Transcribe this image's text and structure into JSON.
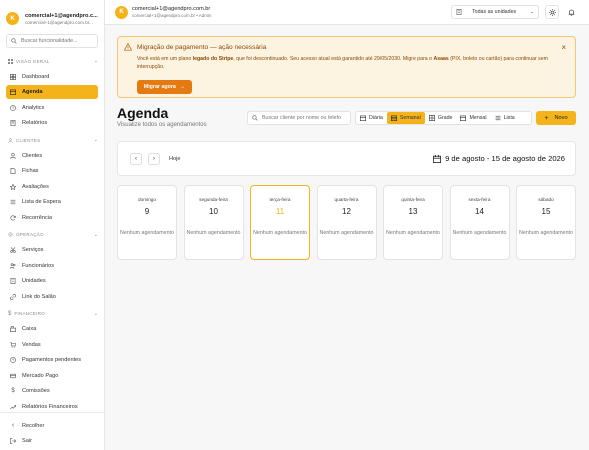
{
  "sidebar": {
    "avatar_initial": "K",
    "user_name": "comercial+1@agendpro.c...",
    "user_email": "comercial+1@agendpro.com.br...",
    "search_placeholder": "Buscar funcionalidade...",
    "sections": [
      {
        "label": "VISÃO GERAL",
        "items": [
          "Dashboard",
          "Agenda",
          "Analytics",
          "Relatórios"
        ]
      },
      {
        "label": "CLIENTES",
        "items": [
          "Clientes",
          "Fichas",
          "Avaliações",
          "Lista de Espera",
          "Recorrência"
        ]
      },
      {
        "label": "OPERAÇÃO",
        "items": [
          "Serviços",
          "Funcionários",
          "Unidades",
          "Link do Salão"
        ]
      },
      {
        "label": "FINANCEIRO",
        "items": [
          "Caixa",
          "Vendas",
          "Pagamentos pendentes",
          "Mercado Pago",
          "Comissões",
          "Relatórios Financeiros"
        ]
      }
    ],
    "active_item": "Agenda",
    "collapse_label": "Recolher",
    "logout_label": "Sair"
  },
  "topbar": {
    "avatar_initial": "K",
    "user_name": "comercial+1@agendpro.com.br",
    "user_sub": "comercial+1@agendpro.com.br • Admin",
    "unit_select": "Todas as unidades"
  },
  "banner": {
    "title": "Migração de pagamento — ação necessária",
    "msg_part1": "Você está em um plano ",
    "msg_bold1": "legado do Stripe",
    "msg_part2": ", que foi descontinuado. Seu acesso atual está garantido até 29/05/2030. Migre para o ",
    "msg_bold2": "Asaas",
    "msg_part3": " (PIX, boleto ou cartão) para continuar sem interrupção.",
    "button": "Migrar agora"
  },
  "page": {
    "title": "Agenda",
    "subtitle": "Visualize todos os agendamentos",
    "search_placeholder": "Buscar cliente por nome ou telefo",
    "views": [
      "Diária",
      "Semanal",
      "Grade",
      "Mensal",
      "Lista"
    ],
    "active_view": "Semanal",
    "new_button": "Novo",
    "today_label": "Hoje",
    "date_range": "9 de agosto - 15 de agosto de 2026"
  },
  "week": {
    "empty_label": "Nenhum agendamento",
    "days": [
      {
        "name": "domingo",
        "num": "9"
      },
      {
        "name": "segunda-feira",
        "num": "10"
      },
      {
        "name": "terça-feira",
        "num": "11"
      },
      {
        "name": "quarta-feira",
        "num": "12"
      },
      {
        "name": "quinta-feira",
        "num": "13"
      },
      {
        "name": "sexta-feira",
        "num": "14"
      },
      {
        "name": "sábado",
        "num": "15"
      }
    ],
    "today_index": 2
  },
  "colors": {
    "accent": "#f4b21b",
    "banner_bg": "#fdf3e1",
    "banner_text": "#8a4a06",
    "banner_button": "#e47a12"
  }
}
